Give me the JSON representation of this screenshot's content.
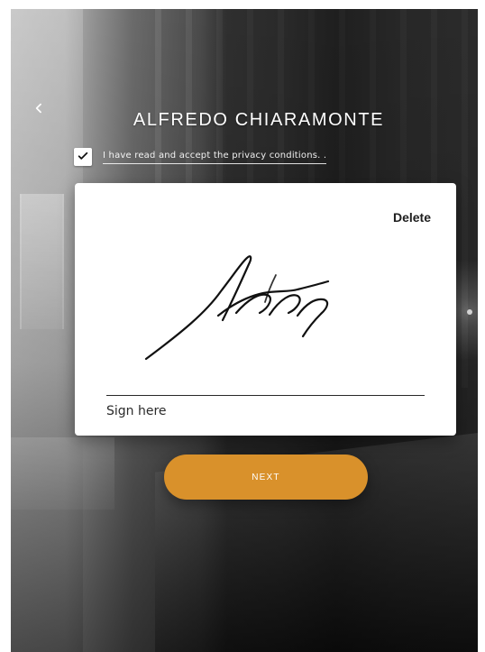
{
  "header": {
    "back_icon": "chevron-left-icon",
    "title": "ALFREDO CHIARAMONTE"
  },
  "privacy": {
    "checked": true,
    "check_icon": "checkmark-icon",
    "text": "I have read and accept the privacy conditions. ."
  },
  "signature_card": {
    "delete_label": "Delete",
    "sign_hint": "Sign here"
  },
  "actions": {
    "next_label": "NEXT"
  },
  "colors": {
    "accent": "#d9912b"
  }
}
